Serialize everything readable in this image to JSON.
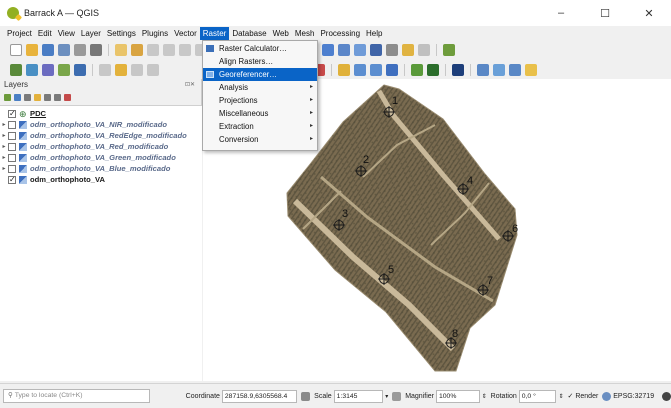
{
  "window": {
    "title": "Barrack A — QGIS",
    "minimize": "–",
    "maximize": "☐",
    "close": "✕"
  },
  "menu": [
    "Project",
    "Edit",
    "View",
    "Layer",
    "Settings",
    "Plugins",
    "Vector",
    "Raster",
    "Database",
    "Web",
    "Mesh",
    "Processing",
    "Help"
  ],
  "active_menu": "Raster",
  "raster_menu": {
    "items": [
      {
        "label": "Raster Calculator…",
        "submenu": false,
        "icon": "calculator-icon"
      },
      {
        "label": "Align Rasters…",
        "submenu": false,
        "icon": ""
      },
      {
        "label": "Georeferencer…",
        "submenu": false,
        "icon": "georeferencer-icon",
        "highlighted": true
      },
      {
        "label": "Analysis",
        "submenu": true
      },
      {
        "label": "Projections",
        "submenu": true
      },
      {
        "label": "Miscellaneous",
        "submenu": true
      },
      {
        "label": "Extraction",
        "submenu": true
      },
      {
        "label": "Conversion",
        "submenu": true
      }
    ],
    "submenu_arrow": "▸"
  },
  "layers_panel": {
    "title": "Layers",
    "dock_buttons": "⊡✕",
    "layers": [
      {
        "name": "PDC",
        "checked": true,
        "expander": "",
        "type": "point-layer",
        "style": "pdc"
      },
      {
        "name": "odm_orthophoto_VA_NIR_modificado",
        "checked": false,
        "expander": "▸",
        "type": "raster-layer",
        "style": "italic"
      },
      {
        "name": "odm_orthophoto_VA_RedEdge_modificado",
        "checked": false,
        "expander": "▸",
        "type": "raster-layer",
        "style": "italic"
      },
      {
        "name": "odm_orthophoto_VA_Red_modificado",
        "checked": false,
        "expander": "▸",
        "type": "raster-layer",
        "style": "italic"
      },
      {
        "name": "odm_orthophoto_VA_Green_modificado",
        "checked": false,
        "expander": "▸",
        "type": "raster-layer",
        "style": "italic"
      },
      {
        "name": "odm_orthophoto_VA_Blue_modificado",
        "checked": false,
        "expander": "▸",
        "type": "raster-layer",
        "style": "italic"
      },
      {
        "name": "odm_orthophoto_VA",
        "checked": true,
        "expander": "",
        "type": "raster-layer",
        "style": "normal"
      }
    ],
    "check_mark": "✓"
  },
  "map": {
    "points": [
      {
        "label": "1"
      },
      {
        "label": "2"
      },
      {
        "label": "3"
      },
      {
        "label": "4"
      },
      {
        "label": "5"
      },
      {
        "label": "6"
      },
      {
        "label": "7"
      },
      {
        "label": "8"
      }
    ]
  },
  "status": {
    "locate_placeholder": "Type to locate (Ctrl+K)",
    "coordinate_label": "Coordinate",
    "coordinate_value": "287158.9,6305568.4",
    "scale_label": "Scale",
    "scale_value": "1:3145",
    "magnifier_label": "Magnifier",
    "magnifier_value": "100%",
    "rotation_label": "Rotation",
    "rotation_value": "0,0 °",
    "render_label": "Render",
    "render_check": "✓",
    "crs_label": "EPSG:32719"
  },
  "colors": {
    "accent": "#0a64c7",
    "qgis_green": "#93b023",
    "field": "#7e6f54",
    "road": "#b8a78a"
  }
}
